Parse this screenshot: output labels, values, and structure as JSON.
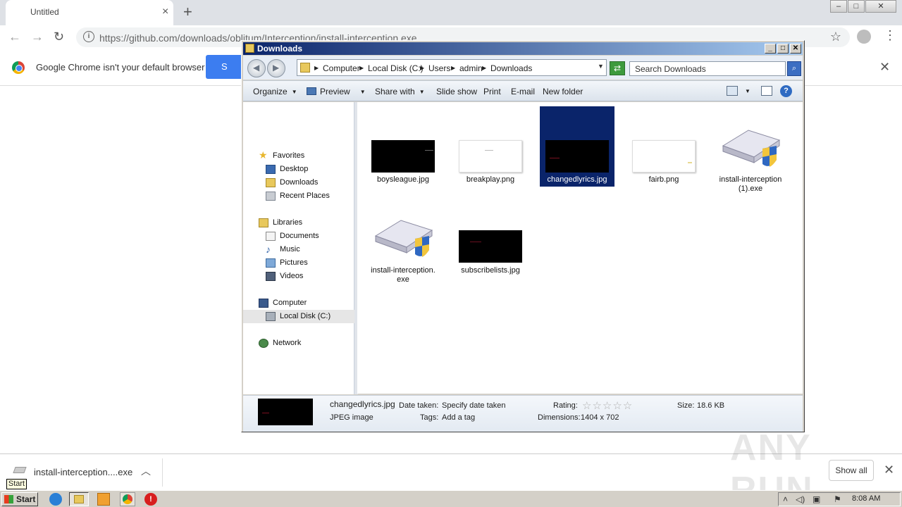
{
  "browser": {
    "tab_title": "Untitled",
    "tab_close": "×",
    "new_tab": "+",
    "url": "https://github.com/downloads/oblitum/Interception/install-interception.exe",
    "infobar_text": "Google Chrome isn't your default browser",
    "infobar_button": "S",
    "close_glyph": "✕"
  },
  "explorer": {
    "title": "Downloads",
    "breadcrumbs": [
      "Computer",
      "Local Disk (C:)",
      "Users",
      "admin",
      "Downloads"
    ],
    "search_placeholder": "Search Downloads",
    "commands": [
      "Organize",
      "Preview",
      "Share with",
      "Slide show",
      "Print",
      "E-mail",
      "New folder"
    ],
    "nav": {
      "favorites": "Favorites",
      "desktop": "Desktop",
      "downloads": "Downloads",
      "recent": "Recent Places",
      "libraries": "Libraries",
      "documents": "Documents",
      "music": "Music",
      "pictures": "Pictures",
      "videos": "Videos",
      "computer": "Computer",
      "local_disk": "Local Disk (C:)",
      "network": "Network"
    },
    "files": [
      {
        "name": "boysleague.jpg",
        "kind": "dark-image"
      },
      {
        "name": "breakplay.png",
        "kind": "light-image"
      },
      {
        "name": "changedlyrics.jpg",
        "kind": "dark-image",
        "selected": true
      },
      {
        "name": "fairb.png",
        "kind": "light-image"
      },
      {
        "name": "install-interception (1).exe",
        "line1": "install-interception",
        "line2": "(1).exe",
        "kind": "installer-icon"
      },
      {
        "name": "install-interception.exe",
        "line1": "install-interception.",
        "line2": "exe",
        "kind": "installer-icon"
      },
      {
        "name": "subscribelists.jpg",
        "kind": "dark-image"
      }
    ],
    "details": {
      "filename": "changedlyrics.jpg",
      "filetype": "JPEG image",
      "date_label": "Date taken:",
      "date_value": "Specify date taken",
      "tags_label": "Tags:",
      "tags_value": "Add a tag",
      "rating_label": "Rating:",
      "dimensions_label": "Dimensions:",
      "dimensions_value": "1404 x 702",
      "size_label": "Size:",
      "size_value": "18.6 KB"
    }
  },
  "downloads_bar": {
    "item": "install-interception....exe",
    "show_all": "Show all"
  },
  "taskbar": {
    "start": "Start",
    "tooltip": "Start",
    "clock": "8:08 AM"
  },
  "watermark": "ANY RUN",
  "colors": {
    "selection": "#0a246a",
    "chrome_button": "#3c7df0",
    "title_gradient_start": "#0a246a"
  }
}
